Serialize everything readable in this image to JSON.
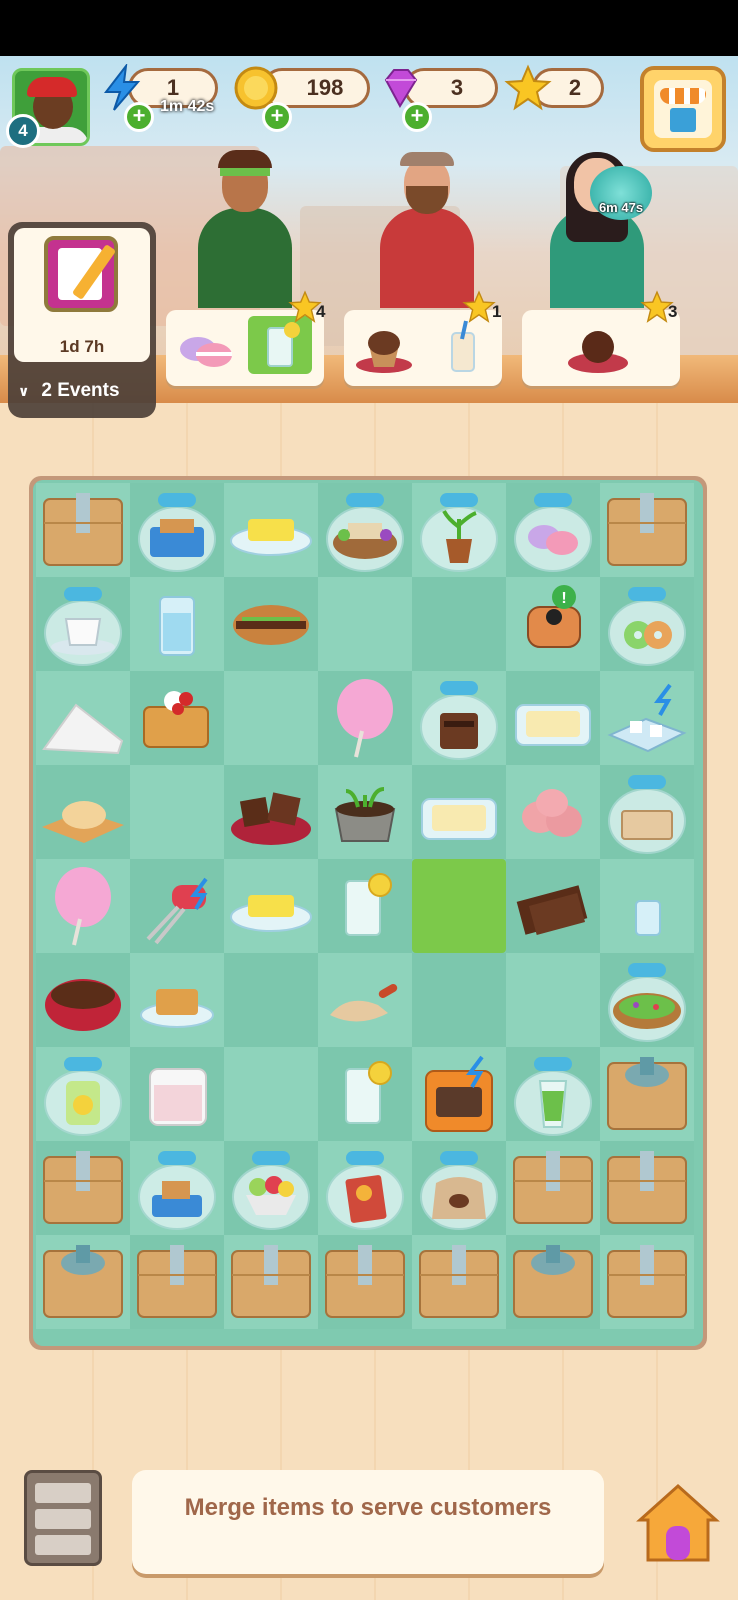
{
  "hud": {
    "player_level": "4",
    "energy": "1",
    "energy_timer": "1m 42s",
    "coins": "198",
    "gems": "3",
    "stars": "2",
    "icons": {
      "energy": "lightning-icon",
      "coins": "coin-icon",
      "gems": "gem-icon",
      "stars": "star-icon",
      "shop": "shop-icon"
    }
  },
  "events": {
    "timer": "1d 7h",
    "toggle_label": "2 Events"
  },
  "customers": [
    {
      "name": "customer-headband-man",
      "stars": "4",
      "orders": [
        "macarons",
        "lemonade"
      ],
      "ready": [
        false,
        true
      ]
    },
    {
      "name": "customer-bearded-man",
      "stars": "1",
      "orders": [
        "cupcake",
        "bubble-tea"
      ],
      "ready": [
        false,
        false
      ]
    },
    {
      "name": "customer-woman",
      "stars": "3",
      "orders": [
        "chocolate-dessert"
      ],
      "ready": [
        false
      ],
      "timer": "6m 47s"
    }
  ],
  "board": {
    "columns": 7,
    "rows": 9,
    "selected": "4,4",
    "cells": [
      [
        "box",
        "jar-bread-blue",
        "butter",
        "jar-salad",
        "jar-plant",
        "jar-macarons",
        "box"
      ],
      [
        "jar-coffee-cup",
        "water-glass",
        "sandwich",
        "",
        "",
        "film-roll",
        "jar-donuts"
      ],
      [
        "flour",
        "waffle",
        "",
        "cotton-candy",
        "jar-coffee-grinder",
        "butter-tray",
        "ice-tray"
      ],
      [
        "dough-board",
        "",
        "brownies",
        "sprout-pot",
        "butter-tray",
        "pig-figures",
        "jar-box"
      ],
      [
        "cotton-candy",
        "mixer",
        "butter",
        "lemonade",
        "",
        "chocolate-bar",
        "small-glass"
      ],
      [
        "chocolate-bowl",
        "pastry",
        "",
        "flour-scoop",
        "",
        "",
        "jar-sprinkles"
      ],
      [
        "jar-lemon",
        "measuring-cup",
        "",
        "lemonade",
        "oven",
        "jar-green-drink",
        "box-jar"
      ],
      [
        "box",
        "jar-toaster",
        "jar-fruit-bowl",
        "jar-cookbook",
        "jar-coffee-sack",
        "box",
        "box"
      ],
      [
        "box-jar",
        "box",
        "box",
        "box",
        "box",
        "box-jar",
        "box"
      ]
    ]
  },
  "footer": {
    "hint": "Merge items to serve customers",
    "icons": {
      "storage": "storage-drawer-icon",
      "home": "home-icon"
    }
  },
  "colors": {
    "board_bg": "#7fcab0",
    "accent_green": "#4caf2e",
    "hint_text": "#a0674a"
  }
}
